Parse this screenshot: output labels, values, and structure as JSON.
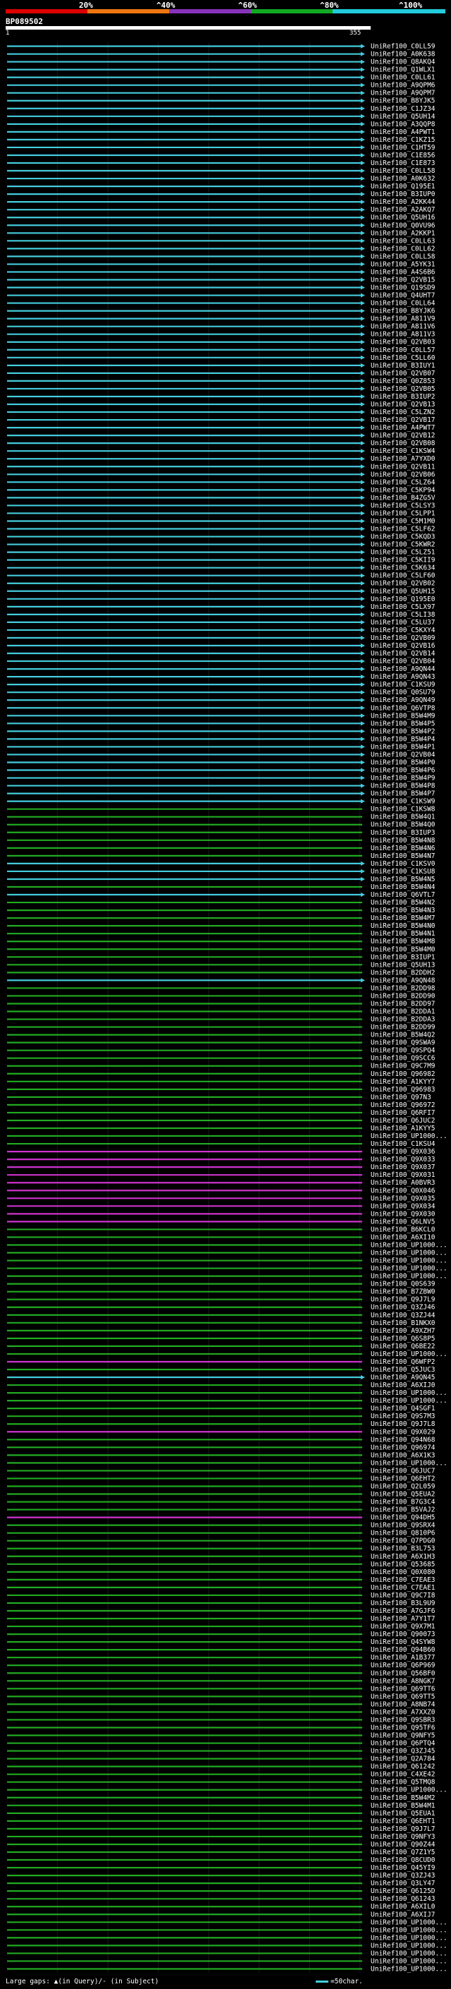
{
  "scale": {
    "labels": [
      "20%",
      "^40%",
      "^60%",
      "^80%",
      "^100%"
    ],
    "bands": [
      {
        "name": "0-20",
        "color": "#dd0000"
      },
      {
        "name": "20-40",
        "color": "#ee7711"
      },
      {
        "name": "40-60",
        "color": "#8833bb"
      },
      {
        "name": "60-80",
        "color": "#11aa22"
      },
      {
        "name": "80-100",
        "color": "#22ccdd"
      }
    ]
  },
  "query": {
    "id": "BP089502",
    "start": "1",
    "end": "355"
  },
  "colors": {
    "identity_80_100": "#44ccdd",
    "identity_60_80": "#22aa22",
    "identity_40_60": "#cc33cc",
    "gap_marker": "#f0f0b0",
    "background": "#000000"
  },
  "hits": [
    {
      "label": "UniRef100_C0LL59",
      "band": "hi"
    },
    {
      "label": "UniRef100_A0K638",
      "band": "hi"
    },
    {
      "label": "UniRef100_Q8AKQ4",
      "band": "hi"
    },
    {
      "label": "UniRef100_Q1WLX1",
      "band": "hi"
    },
    {
      "label": "UniRef100_C0LL61",
      "band": "hi"
    },
    {
      "label": "UniRef100_A9QPM6",
      "band": "hi"
    },
    {
      "label": "UniRef100_A9QPM7",
      "band": "hi"
    },
    {
      "label": "UniRef100_B8YJK5",
      "band": "hi"
    },
    {
      "label": "UniRef100_C1JZ34",
      "band": "hi"
    },
    {
      "label": "UniRef100_Q5UH14",
      "band": "hi"
    },
    {
      "label": "UniRef100_A3QQP8",
      "band": "hi"
    },
    {
      "label": "UniRef100_A4PWT1",
      "band": "hi"
    },
    {
      "label": "UniRef100_C1KZ15",
      "band": "hi"
    },
    {
      "label": "UniRef100_C1HT59",
      "band": "hi"
    },
    {
      "label": "UniRef100_C1E856",
      "band": "hi"
    },
    {
      "label": "UniRef100_C1E873",
      "band": "hi"
    },
    {
      "label": "UniRef100_C0LL58",
      "band": "hi"
    },
    {
      "label": "UniRef100_A0K632",
      "band": "hi"
    },
    {
      "label": "UniRef100_Q195E1",
      "band": "hi"
    },
    {
      "label": "UniRef100_B3IUP0",
      "band": "hi"
    },
    {
      "label": "UniRef100_A2KK44",
      "band": "hi"
    },
    {
      "label": "UniRef100_A2AKQ7",
      "band": "hi"
    },
    {
      "label": "UniRef100_Q5UH16",
      "band": "hi"
    },
    {
      "label": "UniRef100_Q0VU96",
      "band": "hi"
    },
    {
      "label": "UniRef100_A2KKP1",
      "band": "hi"
    },
    {
      "label": "UniRef100_C0LL63",
      "band": "hi"
    },
    {
      "label": "UniRef100_C0LL62",
      "band": "hi"
    },
    {
      "label": "UniRef100_C0LL58",
      "band": "hi"
    },
    {
      "label": "UniRef100_A5YK31",
      "band": "hi"
    },
    {
      "label": "UniRef100_A4S6B6",
      "band": "hi"
    },
    {
      "label": "UniRef100_Q2VB15",
      "band": "hi"
    },
    {
      "label": "UniRef100_Q19SD9",
      "band": "hi"
    },
    {
      "label": "UniRef100_Q4UHT7",
      "band": "hi"
    },
    {
      "label": "UniRef100_C0LL64",
      "band": "hi"
    },
    {
      "label": "UniRef100_B8YJK6",
      "band": "hi"
    },
    {
      "label": "UniRef100_A811V9",
      "band": "hi"
    },
    {
      "label": "UniRef100_A811V6",
      "band": "hi"
    },
    {
      "label": "UniRef100_A811V3",
      "band": "hi"
    },
    {
      "label": "UniRef100_Q2VB03",
      "band": "hi"
    },
    {
      "label": "UniRef100_C0LL57",
      "band": "hi"
    },
    {
      "label": "UniRef100_C5LL60",
      "band": "hi"
    },
    {
      "label": "UniRef100_B3IUY1",
      "band": "hi"
    },
    {
      "label": "UniRef100_Q2VB07",
      "band": "hi"
    },
    {
      "label": "UniRef100_Q0Z853",
      "band": "hi"
    },
    {
      "label": "UniRef100_Q2VB05",
      "band": "hi"
    },
    {
      "label": "UniRef100_B3IUP2",
      "band": "hi"
    },
    {
      "label": "UniRef100_Q2VB13",
      "band": "hi"
    },
    {
      "label": "UniRef100_C5LZN2",
      "band": "hi"
    },
    {
      "label": "UniRef100_Q2VB17",
      "band": "hi"
    },
    {
      "label": "UniRef100_A4PWT7",
      "band": "hi"
    },
    {
      "label": "UniRef100_Q2VB12",
      "band": "hi"
    },
    {
      "label": "UniRef100_Q2VB08",
      "band": "hi"
    },
    {
      "label": "UniRef100_C1KSW4",
      "band": "hi"
    },
    {
      "label": "UniRef100_A7YXD0",
      "band": "hi"
    },
    {
      "label": "UniRef100_Q2VB11",
      "band": "hi"
    },
    {
      "label": "UniRef100_Q2VB06",
      "band": "hi"
    },
    {
      "label": "UniRef100_C5LZ64",
      "band": "hi"
    },
    {
      "label": "UniRef100_C5KP94",
      "band": "hi"
    },
    {
      "label": "UniRef100_B4ZG5V",
      "band": "hi"
    },
    {
      "label": "UniRef100_C5LSY3",
      "band": "hi"
    },
    {
      "label": "UniRef100_C5LPP1",
      "band": "hi"
    },
    {
      "label": "UniRef100_C5M1M0",
      "band": "hi"
    },
    {
      "label": "UniRef100_C5LF62",
      "band": "hi"
    },
    {
      "label": "UniRef100_C5KQD3",
      "band": "hi"
    },
    {
      "label": "UniRef100_C5KWR2",
      "band": "hi"
    },
    {
      "label": "UniRef100_C5LZ51",
      "band": "hi"
    },
    {
      "label": "UniRef100_C5KII9",
      "band": "hi"
    },
    {
      "label": "UniRef100_C5K634",
      "band": "hi"
    },
    {
      "label": "UniRef100_C5LF60",
      "band": "hi"
    },
    {
      "label": "UniRef100_Q2VB02",
      "band": "hi"
    },
    {
      "label": "UniRef100_Q5UH15",
      "band": "hi"
    },
    {
      "label": "UniRef100_Q195E0",
      "band": "hi"
    },
    {
      "label": "UniRef100_C5LX97",
      "band": "hi"
    },
    {
      "label": "UniRef100_C5LI38",
      "band": "hi"
    },
    {
      "label": "UniRef100_C5LU37",
      "band": "hi"
    },
    {
      "label": "UniRef100_C5KXY4",
      "band": "hi"
    },
    {
      "label": "UniRef100_Q2VB09",
      "band": "hi"
    },
    {
      "label": "UniRef100_Q2VB16",
      "band": "hi"
    },
    {
      "label": "UniRef100_Q2VB14",
      "band": "hi"
    },
    {
      "label": "UniRef100_Q2VB04",
      "band": "hi"
    },
    {
      "label": "UniRef100_A9QN44",
      "band": "hi"
    },
    {
      "label": "UniRef100_A9QN43",
      "band": "hi"
    },
    {
      "label": "UniRef100_C1KSU9",
      "band": "hi"
    },
    {
      "label": "UniRef100_Q0SU79",
      "band": "hi"
    },
    {
      "label": "UniRef100_A9QN49",
      "band": "hi"
    },
    {
      "label": "UniRef100_Q6VTP8",
      "band": "hi"
    },
    {
      "label": "UniRef100_B5W4M9",
      "band": "hi"
    },
    {
      "label": "UniRef100_B5W4P5",
      "band": "hi"
    },
    {
      "label": "UniRef100_B5W4P2",
      "band": "hi"
    },
    {
      "label": "UniRef100_B5W4P4",
      "band": "hi"
    },
    {
      "label": "UniRef100_B5W4P1",
      "band": "hi"
    },
    {
      "label": "UniRef100_Q2VB04",
      "band": "hi"
    },
    {
      "label": "UniRef100_B5W4P0",
      "band": "hi"
    },
    {
      "label": "UniRef100_B5W4P6",
      "band": "hi"
    },
    {
      "label": "UniRef100_B5W4P9",
      "band": "hi"
    },
    {
      "label": "UniRef100_B5W4P8",
      "band": "hi"
    },
    {
      "label": "UniRef100_B5W4P7",
      "band": "hi"
    },
    {
      "label": "UniRef100_C1KSW9",
      "band": "hi"
    },
    {
      "label": "UniRef100_C1KSW8",
      "band": "mid"
    },
    {
      "label": "UniRef100_B5W4Q1",
      "band": "mid"
    },
    {
      "label": "UniRef100_B5W4Q0",
      "band": "mid"
    },
    {
      "label": "UniRef100_B3IUP3",
      "band": "mid"
    },
    {
      "label": "UniRef100_B5W4N8",
      "band": "mid"
    },
    {
      "label": "UniRef100_B5W4N6",
      "band": "mid"
    },
    {
      "label": "UniRef100_B5W4N7",
      "band": "mid"
    },
    {
      "label": "UniRef100_C1KSV0",
      "band": "hi"
    },
    {
      "label": "UniRef100_C1KSU8",
      "band": "hi"
    },
    {
      "label": "UniRef100_B5W4N5",
      "band": "hi"
    },
    {
      "label": "UniRef100_B5W4N4",
      "band": "mid"
    },
    {
      "label": "UniRef100_Q6VTL7",
      "band": "hi"
    },
    {
      "label": "UniRef100_B5W4N2",
      "band": "mid"
    },
    {
      "label": "UniRef100_B5W4N3",
      "band": "mid"
    },
    {
      "label": "UniRef100_B5W4M7",
      "band": "mid"
    },
    {
      "label": "UniRef100_B5W4N0",
      "band": "mid"
    },
    {
      "label": "UniRef100_B5W4N1",
      "band": "mid"
    },
    {
      "label": "UniRef100_B5W4M8",
      "band": "mid"
    },
    {
      "label": "UniRef100_B5W4M0",
      "band": "mid"
    },
    {
      "label": "UniRef100_B3IUP1",
      "band": "mid"
    },
    {
      "label": "UniRef100_Q5UH13",
      "band": "mid"
    },
    {
      "label": "UniRef100_B2DDH2",
      "band": "mid"
    },
    {
      "label": "UniRef100_A9QN48",
      "band": "hi"
    },
    {
      "label": "UniRef100_B2DD98",
      "band": "mid"
    },
    {
      "label": "UniRef100_B2DD90",
      "band": "mid"
    },
    {
      "label": "UniRef100_B2DD97",
      "band": "mid"
    },
    {
      "label": "UniRef100_B2DDA1",
      "band": "mid"
    },
    {
      "label": "UniRef100_B2DDA3",
      "band": "mid"
    },
    {
      "label": "UniRef100_B2DD99",
      "band": "mid"
    },
    {
      "label": "UniRef100_B5W4Q2",
      "band": "mid"
    },
    {
      "label": "UniRef100_Q9SWA9",
      "band": "mid"
    },
    {
      "label": "UniRef100_Q9SPQ4",
      "band": "mid"
    },
    {
      "label": "UniRef100_Q9SCC6",
      "band": "mid"
    },
    {
      "label": "UniRef100_Q9C7M9",
      "band": "mid"
    },
    {
      "label": "UniRef100_Q96982",
      "band": "mid"
    },
    {
      "label": "UniRef100_A1KYY7",
      "band": "mid"
    },
    {
      "label": "UniRef100_Q96983",
      "band": "mid"
    },
    {
      "label": "UniRef100_Q97N3",
      "band": "mid"
    },
    {
      "label": "UniRef100_Q96972",
      "band": "mid"
    },
    {
      "label": "UniRef100_Q6RFI7",
      "band": "mid"
    },
    {
      "label": "UniRef100_Q6JUC2",
      "band": "mid"
    },
    {
      "label": "UniRef100_A1KYY5",
      "band": "mid"
    },
    {
      "label": "UniRef100_UP1000...",
      "band": "mid"
    },
    {
      "label": "UniRef100_C1KSU4",
      "band": "mid"
    },
    {
      "label": "UniRef100_Q9X036",
      "band": "low"
    },
    {
      "label": "UniRef100_Q9X033",
      "band": "low"
    },
    {
      "label": "UniRef100_Q9X037",
      "band": "low"
    },
    {
      "label": "UniRef100_Q9X031",
      "band": "low"
    },
    {
      "label": "UniRef100_A0BVR3",
      "band": "low"
    },
    {
      "label": "UniRef100_Q0X046",
      "band": "low"
    },
    {
      "label": "UniRef100_Q9X035",
      "band": "low"
    },
    {
      "label": "UniRef100_Q9X034",
      "band": "low"
    },
    {
      "label": "UniRef100_Q9X030",
      "band": "low"
    },
    {
      "label": "UniRef100_Q6LNV5",
      "band": "low"
    },
    {
      "label": "UniRef100_B6KCL0",
      "band": "mid"
    },
    {
      "label": "UniRef100_A6XI10",
      "band": "mid"
    },
    {
      "label": "UniRef100_UP1000...",
      "band": "mid"
    },
    {
      "label": "UniRef100_UP1000...",
      "band": "mid"
    },
    {
      "label": "UniRef100_UP1000...",
      "band": "mid"
    },
    {
      "label": "UniRef100_UP1000...",
      "band": "mid"
    },
    {
      "label": "UniRef100_UP1000...",
      "band": "mid"
    },
    {
      "label": "UniRef100_Q0S639",
      "band": "mid"
    },
    {
      "label": "UniRef100_B7ZBW0",
      "band": "mid"
    },
    {
      "label": "UniRef100_Q9J7L9",
      "band": "mid"
    },
    {
      "label": "UniRef100_Q3ZJ46",
      "band": "mid"
    },
    {
      "label": "UniRef100_Q3ZJ44",
      "band": "mid"
    },
    {
      "label": "UniRef100_B1NKX0",
      "band": "mid"
    },
    {
      "label": "UniRef100_A9XZH7",
      "band": "mid"
    },
    {
      "label": "UniRef100_Q6S8P5",
      "band": "mid"
    },
    {
      "label": "UniRef100_Q6BE22",
      "band": "mid"
    },
    {
      "label": "UniRef100_UP1000...",
      "band": "mid"
    },
    {
      "label": "UniRef100_Q6WFP2",
      "band": "low"
    },
    {
      "label": "UniRef100_Q5JUC3",
      "band": "mid"
    },
    {
      "label": "UniRef100_A9QN45",
      "band": "hi"
    },
    {
      "label": "UniRef100_A6XIJ0",
      "band": "mid"
    },
    {
      "label": "UniRef100_UP1000...",
      "band": "mid"
    },
    {
      "label": "UniRef100_UP1000...",
      "band": "mid"
    },
    {
      "label": "UniRef100_Q4SGF1",
      "band": "mid"
    },
    {
      "label": "UniRef100_Q9S7M3",
      "band": "mid"
    },
    {
      "label": "UniRef100_Q9J7L8",
      "band": "mid"
    },
    {
      "label": "UniRef100_Q9X029",
      "band": "low"
    },
    {
      "label": "UniRef100_Q94N68",
      "band": "mid"
    },
    {
      "label": "UniRef100_Q96974",
      "band": "mid"
    },
    {
      "label": "UniRef100_A6X1K3",
      "band": "mid"
    },
    {
      "label": "UniRef100_UP1000...",
      "band": "mid"
    },
    {
      "label": "UniRef100_Q6JUC7",
      "band": "mid"
    },
    {
      "label": "UniRef100_Q6EHT2",
      "band": "mid"
    },
    {
      "label": "UniRef100_Q2L059",
      "band": "mid"
    },
    {
      "label": "UniRef100_Q5EUA2",
      "band": "mid"
    },
    {
      "label": "UniRef100_B7G3C4",
      "band": "mid"
    },
    {
      "label": "UniRef100_B5VAJ2",
      "band": "mid"
    },
    {
      "label": "UniRef100_Q94DH5",
      "band": "low"
    },
    {
      "label": "UniRef100_Q9SRX4",
      "band": "mid"
    },
    {
      "label": "UniRef100_Q810P6",
      "band": "mid"
    },
    {
      "label": "UniRef100_Q7PDG0",
      "band": "mid"
    },
    {
      "label": "UniRef100_B3L753",
      "band": "mid"
    },
    {
      "label": "UniRef100_A6X1H3",
      "band": "mid"
    },
    {
      "label": "UniRef100_Q53685",
      "band": "mid"
    },
    {
      "label": "UniRef100_Q0X080",
      "band": "mid"
    },
    {
      "label": "UniRef100_C7EAE3",
      "band": "mid"
    },
    {
      "label": "UniRef100_C7EAE1",
      "band": "mid"
    },
    {
      "label": "UniRef100_Q9C7I8",
      "band": "mid"
    },
    {
      "label": "UniRef100_B3L9U9",
      "band": "mid"
    },
    {
      "label": "UniRef100_A7GJF6",
      "band": "mid"
    },
    {
      "label": "UniRef100_A7Y1T7",
      "band": "mid"
    },
    {
      "label": "UniRef100_Q9X7M1",
      "band": "mid"
    },
    {
      "label": "UniRef100_Q90073",
      "band": "mid"
    },
    {
      "label": "UniRef100_Q4SYW8",
      "band": "mid"
    },
    {
      "label": "UniRef100_Q94B60",
      "band": "mid"
    },
    {
      "label": "UniRef100_A1B377",
      "band": "mid"
    },
    {
      "label": "UniRef100_Q6P969",
      "band": "mid"
    },
    {
      "label": "UniRef100_Q56BF0",
      "band": "mid"
    },
    {
      "label": "UniRef100_A8NGK7",
      "band": "mid"
    },
    {
      "label": "UniRef100_Q69TT6",
      "band": "mid"
    },
    {
      "label": "UniRef100_Q69TT5",
      "band": "mid"
    },
    {
      "label": "UniRef100_A8NB74",
      "band": "mid"
    },
    {
      "label": "UniRef100_A7XXZ0",
      "band": "mid"
    },
    {
      "label": "UniRef100_Q9SBR3",
      "band": "mid"
    },
    {
      "label": "UniRef100_Q95TF6",
      "band": "mid"
    },
    {
      "label": "UniRef100_Q9NFY5",
      "band": "mid"
    },
    {
      "label": "UniRef100_Q6PTQ4",
      "band": "mid"
    },
    {
      "label": "UniRef100_Q3ZJ45",
      "band": "mid"
    },
    {
      "label": "UniRef100_Q2A784",
      "band": "mid"
    },
    {
      "label": "UniRef100_Q61242",
      "band": "mid"
    },
    {
      "label": "UniRef100_C4XE42",
      "band": "mid"
    },
    {
      "label": "UniRef100_Q5TMQ8",
      "band": "mid"
    },
    {
      "label": "UniRef100_UP1000...",
      "band": "mid"
    },
    {
      "label": "UniRef100_B5W4M2",
      "band": "mid"
    },
    {
      "label": "UniRef100_B5W4M1",
      "band": "mid"
    },
    {
      "label": "UniRef100_Q5EUA1",
      "band": "mid"
    },
    {
      "label": "UniRef100_Q6EHT1",
      "band": "mid"
    },
    {
      "label": "UniRef100_Q9J7L7",
      "band": "mid"
    },
    {
      "label": "UniRef100_Q9NFY3",
      "band": "mid"
    },
    {
      "label": "UniRef100_Q90Z44",
      "band": "mid"
    },
    {
      "label": "UniRef100_Q7Z1Y5",
      "band": "mid"
    },
    {
      "label": "UniRef100_Q8CUD0",
      "band": "mid"
    },
    {
      "label": "UniRef100_Q45YI9",
      "band": "mid"
    },
    {
      "label": "UniRef100_Q3ZJ43",
      "band": "mid"
    },
    {
      "label": "UniRef100_Q3LY47",
      "band": "mid"
    },
    {
      "label": "UniRef100_Q6125D",
      "band": "mid"
    },
    {
      "label": "UniRef100_Q61243",
      "band": "mid"
    },
    {
      "label": "UniRef100_A6XIL0",
      "band": "mid"
    },
    {
      "label": "UniRef100_A6XIJ7",
      "band": "mid"
    },
    {
      "label": "UniRef100_UP1000...",
      "band": "mid"
    },
    {
      "label": "UniRef100_UP1000...",
      "band": "mid"
    },
    {
      "label": "UniRef100_UP1000...",
      "band": "mid"
    },
    {
      "label": "UniRef100_UP1000...",
      "band": "mid"
    },
    {
      "label": "UniRef100_UP1000...",
      "band": "mid"
    },
    {
      "label": "UniRef100_UP1000...",
      "band": "mid"
    },
    {
      "label": "UniRef100_UP1000...",
      "band": "mid"
    }
  ],
  "legend": {
    "left": "Large gaps: ▲(in Query)/- (in Subject)",
    "right": "=50char."
  }
}
